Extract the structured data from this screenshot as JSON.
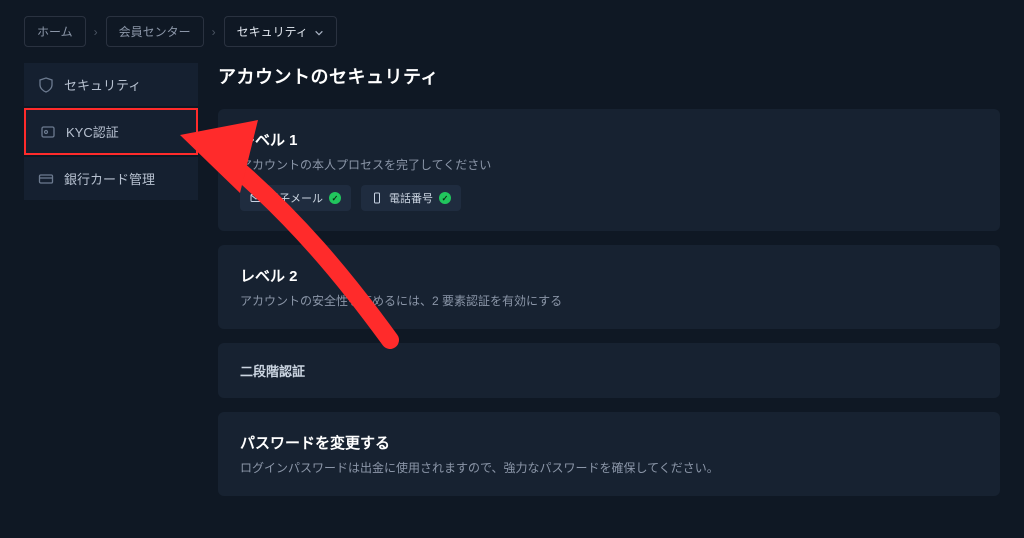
{
  "breadcrumb": {
    "home": "ホーム",
    "center": "会員センター",
    "current": "セキュリティ"
  },
  "sidebar": {
    "items": [
      {
        "label": "セキュリティ",
        "name": "sidebar-item-security"
      },
      {
        "label": "KYC認証",
        "name": "sidebar-item-kyc"
      },
      {
        "label": "銀行カード管理",
        "name": "sidebar-item-bankcard"
      }
    ]
  },
  "main": {
    "title": "アカウントのセキュリティ",
    "level1": {
      "title": "レベル 1",
      "sub": "アカウントの本人プロセスを完了してください",
      "email_label": "電子メール",
      "phone_label": "電話番号"
    },
    "level2": {
      "title": "レベル 2",
      "sub": "アカウントの安全性を高めるには、2 要素認証を有効にする"
    },
    "twofa_label": "二段階認証",
    "password": {
      "title": "パスワードを変更する",
      "sub": "ログインパスワードは出金に使用されますので、強力なパスワードを確保してください。"
    }
  }
}
